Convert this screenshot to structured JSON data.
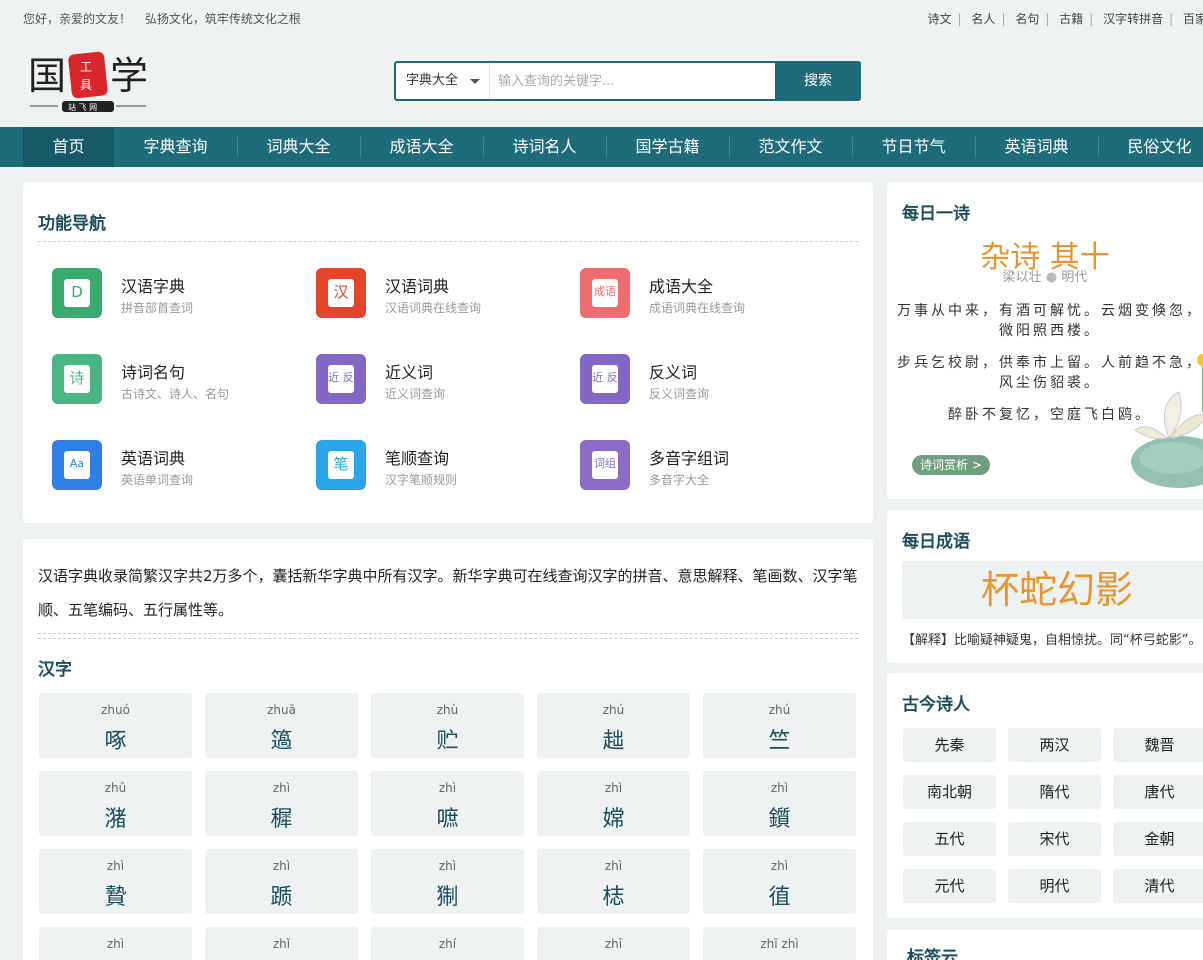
{
  "topbar": {
    "greeting": "您好，亲爱的文友！",
    "slogan": "弘扬文化，筑牢传统文化之根",
    "links": [
      "诗文",
      "名人",
      "名句",
      "古籍",
      "汉字转拼音",
      "百家"
    ]
  },
  "logo": {
    "alt": "国学工具站"
  },
  "search": {
    "scope": "字典大全",
    "placeholder": "输入查询的关键字...",
    "button": "搜索"
  },
  "nav": [
    "首页",
    "字典查询",
    "词典大全",
    "成语大全",
    "诗词名人",
    "国学古籍",
    "范文作文",
    "节日节气",
    "英语词典",
    "民俗文化"
  ],
  "function_nav": {
    "title": "功能导航",
    "items": [
      {
        "name": "汉语字典",
        "desc": "拼音部首查词",
        "glyph": "D",
        "color": "#3aab6e",
        "icon": "dictionary-icon"
      },
      {
        "name": "汉语词典",
        "desc": "汉语词典在线查询",
        "glyph": "汉",
        "color": "#e2452b",
        "icon": "cidian-icon"
      },
      {
        "name": "成语大全",
        "desc": "成语词典在线查询",
        "glyph": "成语",
        "color": "#ee6d6f",
        "icon": "idiom-icon"
      },
      {
        "name": "诗词名句",
        "desc": "古诗文、诗人、名句",
        "glyph": "诗",
        "color": "#4bb585",
        "icon": "poem-icon"
      },
      {
        "name": "近义词",
        "desc": "近义词查询",
        "glyph": "近 反",
        "color": "#8268c2",
        "icon": "synonym-icon"
      },
      {
        "name": "反义词",
        "desc": "反义词查询",
        "glyph": "近 反",
        "color": "#8268c2",
        "icon": "antonym-icon"
      },
      {
        "name": "英语词典",
        "desc": "英语单词查询",
        "glyph": "Aa",
        "color": "#2f7fe6",
        "icon": "english-icon"
      },
      {
        "name": "笔顺查询",
        "desc": "汉字笔顺规则",
        "glyph": "笔",
        "color": "#2aa6e8",
        "icon": "stroke-icon"
      },
      {
        "name": "多音字组词",
        "desc": "多音字大全",
        "glyph": "词组",
        "color": "#8b6ec4",
        "icon": "polyphone-icon"
      }
    ]
  },
  "hanzi": {
    "intro": "汉语字典收录简繁汉字共2万多个，囊括新华字典中所有汉字。新华字典可在线查询汉字的拼音、意思解释、笔画数、汉字笔顺、五笔编码、五行属性等。",
    "title": "汉字",
    "chars": [
      {
        "py": "zhuó",
        "ch": "啄"
      },
      {
        "py": "zhuā",
        "ch": "簻"
      },
      {
        "py": "zhù",
        "ch": "贮"
      },
      {
        "py": "zhú",
        "ch": "趉"
      },
      {
        "py": "zhú",
        "ch": "竺"
      },
      {
        "py": "zhū",
        "ch": "潴"
      },
      {
        "py": "zhì",
        "ch": "穉"
      },
      {
        "py": "zhì",
        "ch": "嗻"
      },
      {
        "py": "zhì",
        "ch": "嫦"
      },
      {
        "py": "zhì",
        "ch": "鑕"
      },
      {
        "py": "zhì",
        "ch": "贄"
      },
      {
        "py": "zhì",
        "ch": "踬"
      },
      {
        "py": "zhì",
        "ch": "猘"
      },
      {
        "py": "zhì",
        "ch": "梽"
      },
      {
        "py": "zhì",
        "ch": "徝"
      },
      {
        "py": "zhì",
        "ch": ""
      },
      {
        "py": "zhǐ",
        "ch": ""
      },
      {
        "py": "zhí",
        "ch": ""
      },
      {
        "py": "zhī",
        "ch": ""
      },
      {
        "py": "zhī zhì",
        "ch": ""
      }
    ]
  },
  "daily_poem": {
    "title": "每日一诗",
    "name": "杂诗 其十",
    "author": "梁以壮",
    "dynasty": "明代",
    "lines": [
      "万事从中来，有酒可解忧。云烟变倏忽，微阳照西楼。",
      "步兵乞校尉，供奉市上留。人前趋不急，风尘伤貂裘。",
      "醉卧不复忆，空庭飞白鸥。"
    ],
    "button": "诗词赏析 >"
  },
  "daily_idiom": {
    "title": "每日成语",
    "idiom": "杯蛇幻影",
    "explanation": "【解释】比喻疑神疑鬼，自相惊扰。同“杯弓蛇影”。"
  },
  "poets": {
    "title": "古今诗人",
    "eras": [
      "先秦",
      "两汉",
      "魏晋",
      "南北朝",
      "隋代",
      "唐代",
      "五代",
      "宋代",
      "金朝",
      "元代",
      "明代",
      "清代"
    ]
  },
  "tags": {
    "title": "标签云"
  }
}
